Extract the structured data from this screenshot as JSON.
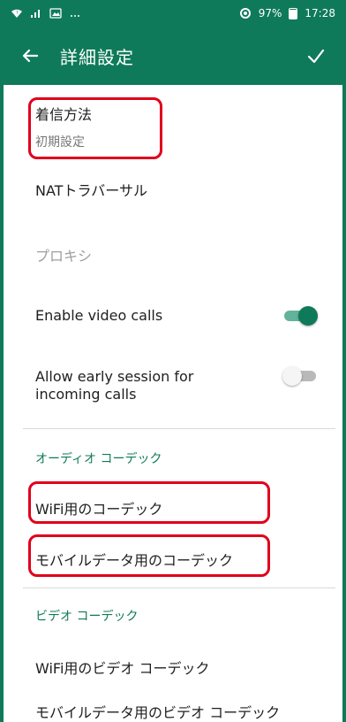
{
  "status_bar": {
    "battery": "97%",
    "time": "17:28",
    "icons": [
      "wifi-icon",
      "signal-icon",
      "gallery-icon",
      "more-icon",
      "sync-icon",
      "battery-icon"
    ]
  },
  "app_bar": {
    "title": "詳細設定",
    "back_icon": "arrow-back-icon",
    "confirm_icon": "check-icon"
  },
  "settings": {
    "incoming_method": {
      "label": "着信方法",
      "summary": "初期設定"
    },
    "nat_traversal": {
      "label": "NATトラバーサル"
    },
    "proxy": {
      "label": "プロキシ"
    },
    "enable_video_calls": {
      "label": "Enable video calls",
      "enabled": true
    },
    "early_session": {
      "label": "Allow early session for incoming calls",
      "enabled": false
    }
  },
  "audio_codec": {
    "header": "オーディオ コーデック",
    "wifi": "WiFi用のコーデック",
    "mobile": "モバイルデータ用のコーデック"
  },
  "video_codec": {
    "header": "ビデオ コーデック",
    "wifi": "WiFi用のビデオ コーデック",
    "mobile": "モバイルデータ用のビデオ コーデック"
  },
  "colors": {
    "primary": "#0f7a5a",
    "highlight": "#e0001b",
    "toggle_on_track": "#62b399",
    "toggle_off_track": "#b9b9b9"
  }
}
